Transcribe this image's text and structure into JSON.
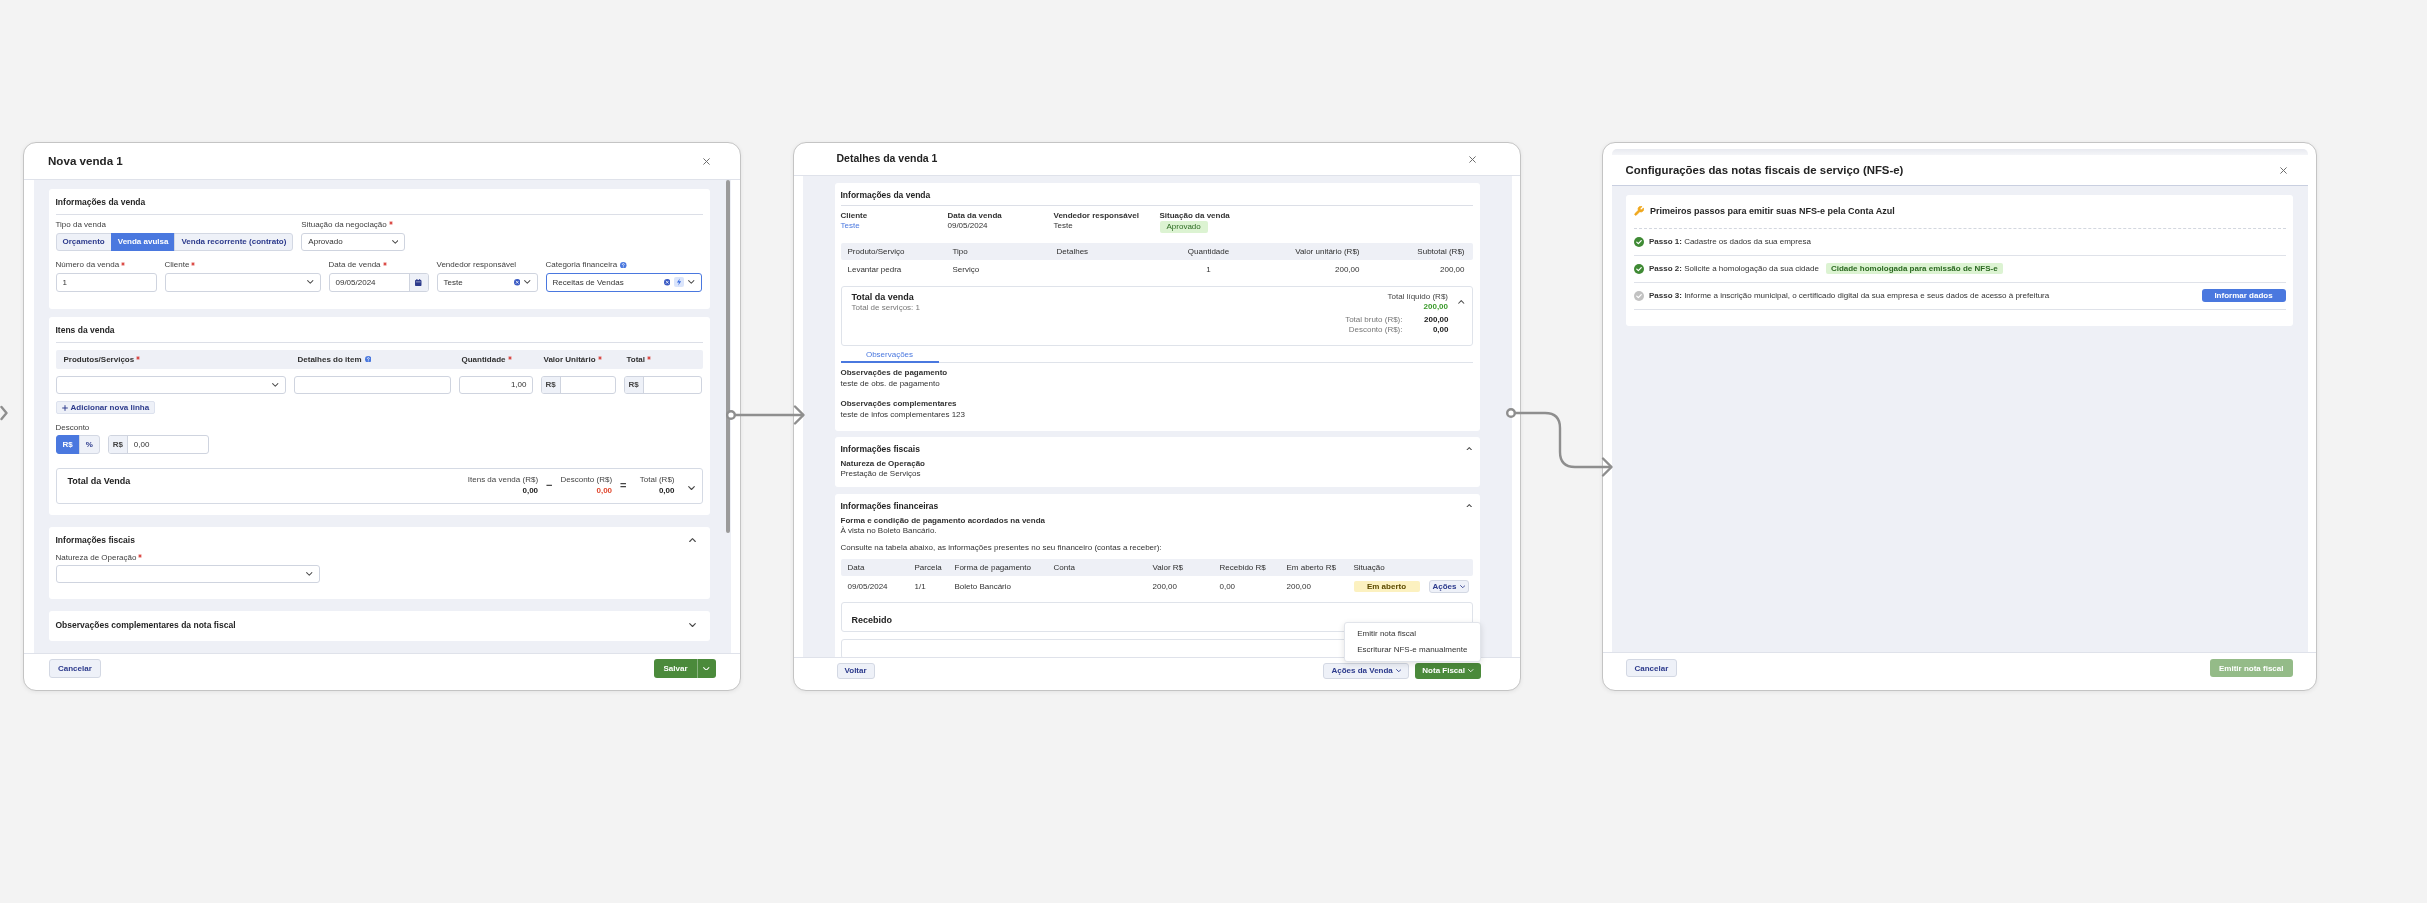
{
  "new_sale_dialog": {
    "title": "Nova venda 1",
    "sale_info": {
      "heading": "Informações da venda",
      "sale_type": {
        "label": "Tipo da venda",
        "options": [
          {
            "label": "Orçamento",
            "selected": false
          },
          {
            "label": "Venda avulsa",
            "selected": true
          },
          {
            "label": "Venda recorrente (contrato)",
            "selected": false
          }
        ]
      },
      "negotiation": {
        "label": "Situação da negociação",
        "required": true,
        "value": "Aprovado"
      },
      "fields": [
        {
          "kind": "text",
          "label": "Número da venda",
          "required": true,
          "help": false,
          "value": "1",
          "clearable": false,
          "quick_action": false,
          "focused": false
        },
        {
          "kind": "select",
          "label": "Cliente",
          "required": true,
          "help": false,
          "clearable": false,
          "quick_action": false,
          "focused": false
        },
        {
          "kind": "date",
          "label": "Data de venda",
          "required": true,
          "help": false,
          "value": "09/05/2024",
          "clearable": false,
          "quick_action": false,
          "focused": false
        },
        {
          "kind": "select",
          "label": "Vendedor responsável",
          "required": false,
          "help": false,
          "value": "Teste",
          "clearable": true,
          "quick_action": false,
          "focused": false
        },
        {
          "kind": "select",
          "label": "Categoria financeira",
          "required": false,
          "help": true,
          "value": "Receitas de Vendas",
          "clearable": true,
          "quick_action": true,
          "focused": true
        }
      ]
    },
    "items": {
      "heading": "Itens da venda",
      "columns": [
        {
          "label": "Produtos/Serviços",
          "required": true,
          "help": false
        },
        {
          "label": "Detalhes do item",
          "required": false,
          "help": true
        },
        {
          "label": "Quantidade",
          "required": true,
          "help": false
        },
        {
          "label": "Valor Unitário",
          "required": true,
          "help": false
        },
        {
          "label": "Total",
          "required": true,
          "help": false
        }
      ],
      "row": [
        {
          "kind": "select"
        },
        {
          "kind": "text"
        },
        {
          "kind": "number",
          "value": "1,00"
        },
        {
          "kind": "currency",
          "prefix": "R$"
        },
        {
          "kind": "currency",
          "prefix": "R$"
        }
      ],
      "add_line": "Adicionar nova linha",
      "discount": {
        "label": "Desconto",
        "modes": [
          {
            "label": "R$",
            "selected": true
          },
          {
            "label": "%",
            "selected": false
          }
        ],
        "prefix": "R$",
        "value": "0,00"
      },
      "total": {
        "title": "Total da Venda",
        "expanded": false,
        "parts": [
          {
            "kind": "amount",
            "label": "Itens da venda (R$)",
            "value": "0,00",
            "negative": false
          },
          {
            "kind": "operator",
            "symbol": "−"
          },
          {
            "kind": "amount",
            "label": "Desconto (R$)",
            "value": "0,00",
            "negative": true
          },
          {
            "kind": "operator",
            "symbol": "="
          },
          {
            "kind": "amount",
            "label": "Total (R$)",
            "value": "0,00",
            "negative": false
          }
        ]
      }
    },
    "fiscal": {
      "heading": "Informações fiscais",
      "expanded": true,
      "field": {
        "label": "Natureza de Operação",
        "required": true
      }
    },
    "invoice_notes": {
      "heading": "Observações complementares da nota fiscal",
      "expanded": false
    },
    "footer": {
      "cancel": "Cancelar",
      "save": "Salvar"
    }
  },
  "sale_details_dialog": {
    "title": "Detalhes da venda 1",
    "sale_info": {
      "heading": "Informações da venda",
      "fields": [
        {
          "kind": "link",
          "label": "Cliente",
          "value": "Teste"
        },
        {
          "kind": "text",
          "label": "Data da venda",
          "value": "09/05/2024"
        },
        {
          "kind": "text",
          "label": "Vendedor responsável",
          "value": "Teste"
        },
        {
          "kind": "badge",
          "label": "Situação da venda",
          "value": "Aprovado"
        }
      ],
      "items_table": {
        "columns": [
          "Produto/Serviço",
          "Tipo",
          "Detalhes",
          "Quantidade",
          "Valor unitário (R$)",
          "Subtotal (R$)"
        ],
        "rows": [
          [
            "Levantar pedra",
            "Serviço",
            null,
            "1",
            "200,00",
            "200,00"
          ]
        ]
      },
      "total": {
        "title": "Total da venda",
        "subtitle": "Total de serviços: 1",
        "net_label": "Total líquido (R$)",
        "net_value": "200,00",
        "expanded": true,
        "breakdown": [
          {
            "label": "Total bruto (R$):",
            "value": "200,00"
          },
          {
            "label": "Desconto (R$):",
            "value": "0,00"
          }
        ]
      },
      "tabs": [
        {
          "label": "Observações",
          "selected": true
        }
      ],
      "notes": [
        {
          "label": "Observações de pagamento",
          "text": "teste de obs. de pagamento"
        },
        {
          "label": "Observações complementares",
          "text": "teste de infos complementares 123"
        }
      ]
    },
    "fiscal": {
      "heading": "Informações fiscais",
      "expanded": true,
      "label": "Natureza de Operação",
      "value": "Prestação de Serviços"
    },
    "financial": {
      "heading": "Informações financeiras",
      "expanded": true,
      "payment_label": "Forma e condição de pagamento acordados na venda",
      "payment_text": "À vista no Boleto Bancário.",
      "hint": "Consulte na tabela abaixo, as informações presentes no seu financeiro (contas a receber):",
      "table": {
        "columns": [
          "Data",
          "Parcela",
          "Forma de pagamento",
          "Conta",
          "Valor R$",
          "Recebido R$",
          "Em aberto R$",
          "Situação"
        ],
        "rows": [
          {
            "cells": [
              "09/05/2024",
              "1/1",
              "Boleto Bancário",
              null,
              "200,00",
              "0,00",
              "200,00"
            ],
            "status": "Em aberto",
            "action": "Ações"
          }
        ]
      },
      "received_title": "Recebido"
    },
    "footer": {
      "back": "Voltar",
      "actions": "Ações da Venda",
      "invoice": "Nota Fiscal"
    },
    "invoice_menu": {
      "open": true,
      "items": [
        "Emitir nota fiscal",
        "Escriturar NFS-e manualmente"
      ]
    }
  },
  "nfse_settings_dialog": {
    "title": "Configurações das notas fiscais de serviço (NFS-e)",
    "heading": "Primeiros passos para emitir suas NFS-e pela Conta Azul",
    "steps": [
      {
        "kind": "text",
        "text": "**Passo 1:** Cadastre os dados da sua empresa",
        "completed": true
      },
      {
        "kind": "badge",
        "text": "**Passo 2:** Solicite a homologação da sua cidade",
        "completed": true,
        "badge": "Cidade homologada para emissão de NFS-e"
      },
      {
        "kind": "action",
        "text": "**Passo 3:** Informe a inscrição municipal, o certificado digital da sua empresa e seus dados de acesso à prefeitura",
        "completed": false,
        "action": "Informar dados"
      }
    ],
    "footer": {
      "cancel": "Cancelar",
      "submit": "Emitir nota fiscal",
      "submit_disabled": true
    }
  }
}
